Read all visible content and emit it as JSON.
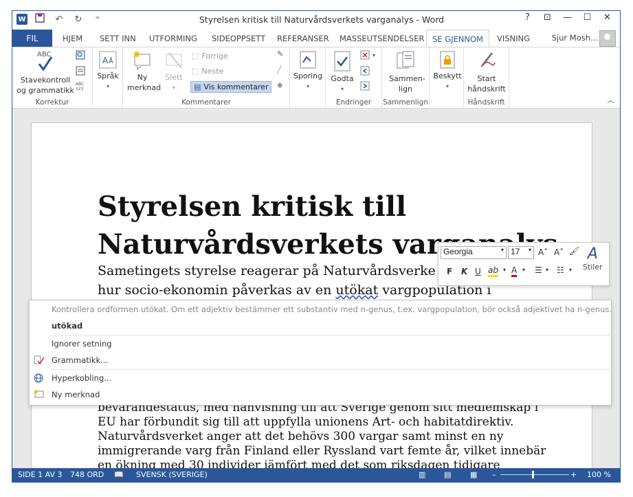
{
  "window": {
    "title": "Styrelsen kritisk till Naturvårdsverkets varganalys - Word"
  },
  "titlebar": {
    "help": "?",
    "restore_ribbon": "⊡",
    "minimize": "—",
    "maximize": "☐",
    "close": "✕",
    "qat_dropdown": "⁼"
  },
  "tabs": [
    {
      "label": "FIL"
    },
    {
      "label": "HJEM"
    },
    {
      "label": "SETT INN"
    },
    {
      "label": "UTFORMING"
    },
    {
      "label": "SIDEOPPSETT"
    },
    {
      "label": "REFERANSER"
    },
    {
      "label": "MASSEUTSENDELSER"
    },
    {
      "label": "SE GJENNOM"
    },
    {
      "label": "VISNING"
    }
  ],
  "user": {
    "name": "Sjur Mosh..."
  },
  "ribbon": {
    "korrektur": {
      "label": "Korrektur",
      "spell": "Stavekontroll og grammatikk",
      "abc": "ABC"
    },
    "sprak": {
      "label": "Språk"
    },
    "kommentarer": {
      "label": "Kommentarer",
      "ny_merknad": "Ny merknad",
      "slett": "Slett",
      "forrige": "Forrige",
      "neste": "Neste",
      "vis": "Vis kommentarer"
    },
    "sporing": {
      "label": "Sporing"
    },
    "endringer": {
      "label": "Endringer",
      "godta": "Godta"
    },
    "sammenlign": {
      "label": "Sammenlign",
      "button": "Sammen-lign"
    },
    "beskytt": {
      "label": "Beskytt"
    },
    "handskrift": {
      "label": "Håndskrift",
      "button": "Start håndskrift"
    }
  },
  "document": {
    "title_line1": "Styrelsen kritisk till",
    "title_line2": "Naturvårdsverkets varganalys",
    "p1_line1": "Sametingets styrelse reagerar på Naturvårdsverke",
    "p1_line2_pre": "hur socio-ekonomin påverkas av en ",
    "p1_line2_flag": "utökat",
    "p1_line2_post": " vargpopulation i",
    "p2": [
      "bevarandestatus, med hänvisning till att Sverige genom sitt medlemskap i",
      "EU har förbundit sig till att uppfylla unionens Art- och habitatdirektiv.",
      "Naturvårdsverket anger att det behövs 300 vargar samt minst en ny",
      "immigrerande varg från Finland eller Ryssland vart femte år, vilket innebär",
      "en ökning med 30 individer jämfört med det som riksdagen tidigare"
    ]
  },
  "minitoolbar": {
    "font": "Georgia",
    "size": "17",
    "bold": "F",
    "italic": "K",
    "underline": "U",
    "styles": "Stiler",
    "grow_font": "A˄",
    "shrink_font": "A˅",
    "highlight": "ab",
    "font_color": "A"
  },
  "context_menu": {
    "hint": "Kontrollera ordformen utökat. Om ett adjektiv bestämmer ett substantiv med n-genus, t.ex. vargpopulation, bör också adjektivet ha n-genus.",
    "suggestion": "utökad",
    "ignore": "Ignorer setning",
    "grammar": "Grammatikk...",
    "hyperlink": "Hyperkobling...",
    "comment": "Ny merknad"
  },
  "status": {
    "page": "SIDE 1 AV 3",
    "words": "748 ORD",
    "language": "SVENSK (SVERIGE)",
    "zoom_minus": "–",
    "zoom_plus": "+",
    "zoom": "100 %"
  },
  "colors": {
    "accent": "#2b579a"
  }
}
